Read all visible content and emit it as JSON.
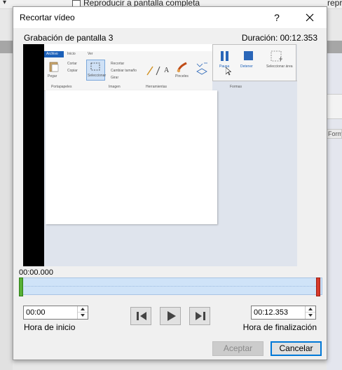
{
  "background": {
    "top_text": "Reproducir a pantalla completa",
    "top_right_text": "repro",
    "right_tab": "Forma"
  },
  "dialog": {
    "title": "Recortar vídeo",
    "help_label": "?",
    "video_name": "Grabación de pantalla 3",
    "duration_label": "Duración: 00:12.353"
  },
  "video_preview": {
    "ribbon_tabs": [
      "Archivo",
      "Inicio",
      "Ver"
    ],
    "ribbon_groups": [
      "Portapapeles",
      "Imagen",
      "Herramientas",
      "Formas"
    ],
    "ribbon_buttons": [
      "Pegar",
      "Cortar",
      "Copiar",
      "Seleccionar",
      "Recortar",
      "Cambiar tamaño",
      "Girar",
      "Pinceles"
    ],
    "popup_buttons": [
      "Pausa",
      "Detener",
      "Seleccionar área"
    ]
  },
  "timeline": {
    "current_time": "00:00.000",
    "start_fraction": 0,
    "end_fraction": 1
  },
  "start_time": {
    "value": "00:00",
    "label": "Hora de inicio"
  },
  "end_time": {
    "value": "00:12.353",
    "label": "Hora de finalización"
  },
  "buttons": {
    "ok": "Aceptar",
    "cancel": "Cancelar"
  },
  "colors": {
    "accent": "#0078d7",
    "start_marker": "#57b036",
    "end_marker": "#d83a2b",
    "timeline_fill": "#cfe3f8"
  }
}
